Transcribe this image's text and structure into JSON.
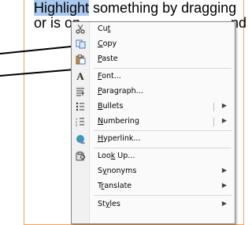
{
  "document": {
    "line1_highlight": "Highlight",
    "line1_rest": " something by dragging",
    "line2_start": "or is on",
    "line2_end": "nd"
  },
  "menu": {
    "items": [
      {
        "pre": "Cu",
        "key": "t",
        "post": "",
        "icon": "scissors-icon"
      },
      {
        "pre": "",
        "key": "C",
        "post": "opy",
        "icon": "copy-icon"
      },
      {
        "pre": "",
        "key": "P",
        "post": "aste",
        "icon": "paste-icon"
      },
      {
        "pre": "",
        "key": "F",
        "post": "ont...",
        "icon": "font-icon"
      },
      {
        "pre": "",
        "key": "P",
        "post": "aragraph...",
        "icon": "paragraph-icon"
      },
      {
        "pre": "",
        "key": "B",
        "post": "ullets",
        "icon": "bullets-icon",
        "submenu": true
      },
      {
        "pre": "",
        "key": "N",
        "post": "umbering",
        "icon": "numbering-icon",
        "submenu": true
      },
      {
        "pre": "",
        "key": "H",
        "post": "yperlink...",
        "icon": "hyperlink-icon"
      },
      {
        "pre": "Loo",
        "key": "k",
        "post": " Up...",
        "icon": "lookup-icon"
      },
      {
        "pre": "S",
        "key": "y",
        "post": "nonyms",
        "submenu": true
      },
      {
        "pre": "T",
        "key": "r",
        "post": "anslate",
        "submenu": true
      },
      {
        "pre": "St",
        "key": "y",
        "post": "les",
        "submenu": true
      }
    ],
    "submenu_arrow": "▶"
  },
  "colors": {
    "selection": "#a9c8ee",
    "page_border": "#f0a35a"
  }
}
